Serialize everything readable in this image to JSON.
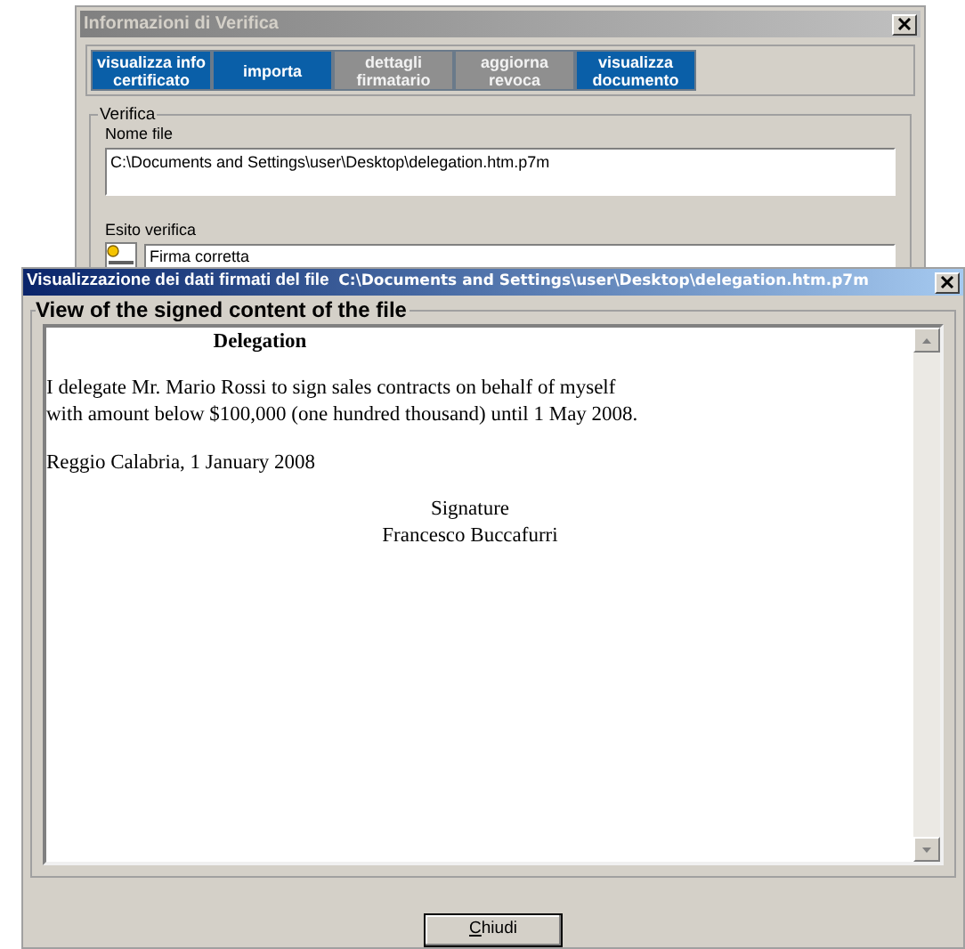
{
  "back_window": {
    "title": "Informazioni di Verifica",
    "tabs": [
      {
        "label": "visualizza info\ncertificato",
        "disabled": false
      },
      {
        "label": "importa",
        "disabled": false
      },
      {
        "label": "dettagli\nfirmatario",
        "disabled": true
      },
      {
        "label": "aggiorna\nrevoca",
        "disabled": true
      },
      {
        "label": "visualizza\ndocumento",
        "disabled": false
      }
    ],
    "group_title": "Verifica",
    "file_label": "Nome file",
    "file_value": "C:\\Documents and Settings\\user\\Desktop\\delegation.htm.p7m",
    "result_label": "Esito verifica",
    "result_value": "Firma corretta"
  },
  "front_window": {
    "title": "Visualizzazione dei dati firmati del file",
    "title_path": "C:\\Documents and Settings\\user\\Desktop\\delegation.htm.p7m",
    "group_title": "View of the signed content of the file",
    "document": {
      "heading": "Delegation",
      "body": "I delegate Mr. Mario Rossi to sign sales contracts on behalf of myself\nwith amount below $100,000 (one hundred thousand) until 1 May 2008.",
      "place_date": "Reggio Calabria, 1 January 2008",
      "signature_label": "Signature",
      "signer": "Francesco Buccafurri"
    },
    "close_button": "Chiudi"
  }
}
